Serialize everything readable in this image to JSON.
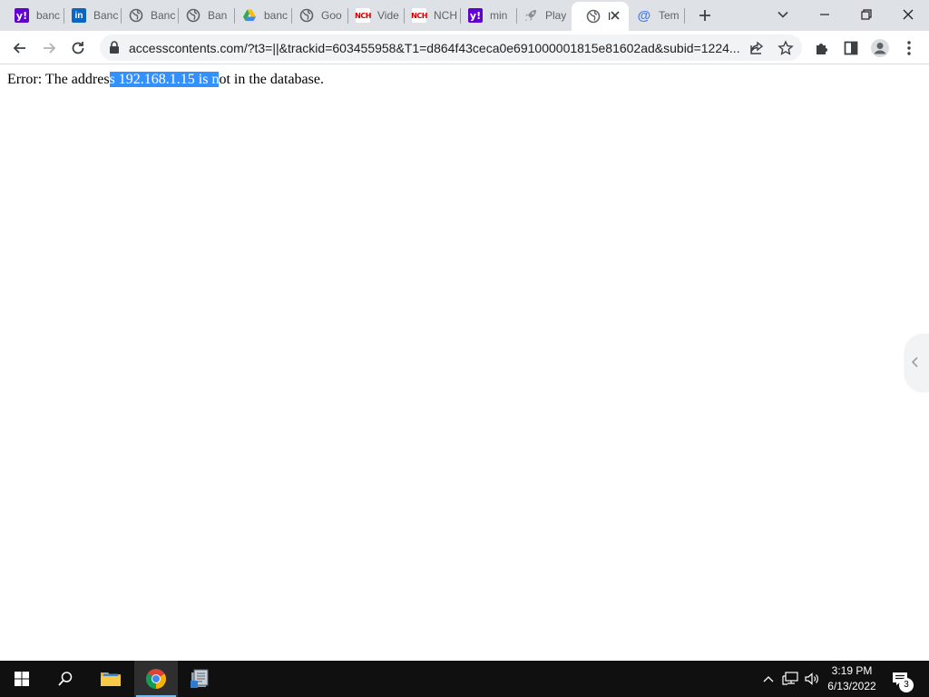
{
  "window": {
    "tabs": [
      {
        "favicon": "yahoo-icon",
        "title": "banc",
        "active": false
      },
      {
        "favicon": "linkedin-icon",
        "title": "Banc",
        "active": false
      },
      {
        "favicon": "globe-icon",
        "title": "Banc",
        "active": false
      },
      {
        "favicon": "globe-icon",
        "title": "Ban",
        "active": false
      },
      {
        "favicon": "google-drive-icon",
        "title": "banc",
        "active": false
      },
      {
        "favicon": "globe-icon",
        "title": "Goo",
        "active": false
      },
      {
        "favicon": "nch-icon",
        "title": "Vide",
        "active": false
      },
      {
        "favicon": "nch-icon",
        "title": "NCH",
        "active": false
      },
      {
        "favicon": "yahoo-icon",
        "title": "min",
        "active": false
      },
      {
        "favicon": "rocket-icon",
        "title": "Play",
        "active": false
      },
      {
        "favicon": "globe-icon",
        "title": "I",
        "active": true
      },
      {
        "favicon": "at-sign-icon",
        "title": "Tem",
        "active": false
      }
    ],
    "favicon_text": {
      "yahoo": "y!",
      "linkedin": "in",
      "nch": "NCH",
      "at": "@"
    }
  },
  "toolbar": {
    "url": "accesscontents.com/?t3=||&trackid=603455958&T1=d864f43ceca0e691000001815e81602ad&subid=1224..."
  },
  "page": {
    "error_before": "Error: The addres",
    "error_selected": "s 192.168.1.15 is n",
    "error_after": "ot in the database."
  },
  "taskbar": {
    "time": "3:19 PM",
    "date": "6/13/2022",
    "notification_count": "3"
  },
  "colors": {
    "selection": "#3390ff",
    "tabstrip": "#dee1e6",
    "taskbar": "#101010"
  }
}
